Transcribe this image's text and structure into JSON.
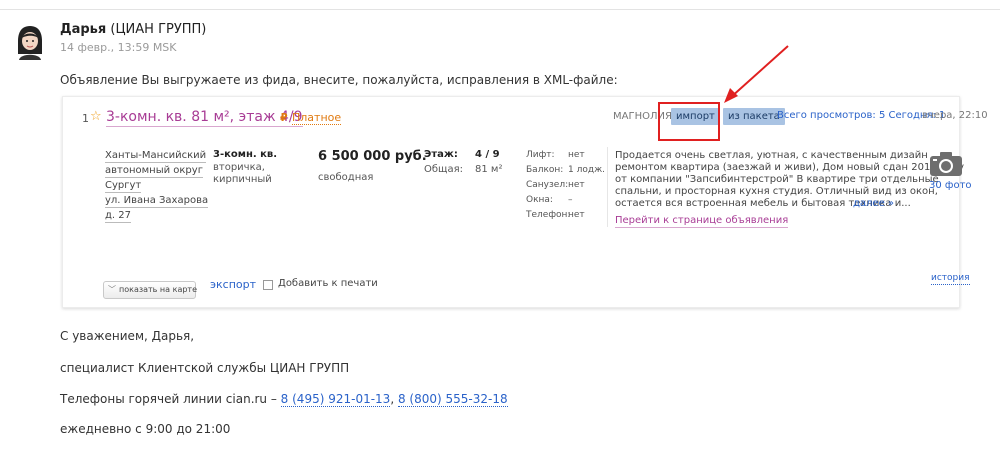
{
  "message": {
    "sender_name": "Дарья",
    "sender_org": "(ЦИАН ГРУПП)",
    "date": "14 февр., 13:59 MSK",
    "intro": "Объявление Вы выгружаете из фида, внесите, пожалуйста, исправления в XML-файле:"
  },
  "listing": {
    "number": "1",
    "title": "3-комн. кв. 81 м², этаж 4/9",
    "paid_symbol": "₽",
    "paid_label": "Платное",
    "agency": "МАГНОЛИЯ",
    "badge_import": "импорт",
    "badge_package": "из пакета",
    "views": "Всего просмотров: 5 Сегодня: 1",
    "timestamp": "вчера, 22:10",
    "address": [
      "Ханты-Мансийский",
      "автономный округ",
      "Сургут",
      "ул. Ивана Захарова",
      "д. 27"
    ],
    "rooms": "3-комн. кв.",
    "rooms_sub": [
      "вторичка,",
      "кирпичный"
    ],
    "price": "6 500 000 руб.",
    "price_sub": "свободная",
    "floor_label": "Этаж:",
    "floor_value": "4 / 9",
    "area_label": "Общая:",
    "area_value": "81 м²",
    "features": [
      {
        "label": "Лифт:",
        "value": "нет"
      },
      {
        "label": "Балкон:",
        "value": "1 лодж."
      },
      {
        "label": "Санузел:",
        "value": "нет"
      },
      {
        "label": "Окна:",
        "value": "–"
      },
      {
        "label": "Телефон:",
        "value": "нет"
      }
    ],
    "description": [
      "Продается очень светлая, уютная, с качественным дизайн",
      "ремонтом квартира (заезжай и живи), Дом новый сдан 2010 году",
      "от компании \"Запсибинтерстрой\" В квартире три отдельные",
      "спальни, и просторная кухня студия. Отличный вид из окон,",
      "остается вся встроенная мебель и бытовая техника и..."
    ],
    "more": "далее »",
    "goto_link": "Перейти к странице объявления",
    "photos": "30 фото",
    "map_button": "показать на карте",
    "export": "экспорт",
    "print_label": "Добавить к печати",
    "history": "история"
  },
  "signature": {
    "greeting": "С уважением, Дарья,",
    "role": "специалист Клиентской службы ЦИАН ГРУПП",
    "phones_prefix": "Телефоны горячей линии cian.ru – ",
    "phone1": "8 (495) 921-01-13",
    "separator": ", ",
    "phone2": "8 (800) 555-32-18",
    "hours": "ежедневно с 9:00 до 21:00"
  },
  "colors": {
    "title": "#a83c95",
    "link": "#2a62c9",
    "badge": "#a9c3e3",
    "highlight": "#e02020",
    "paid": "#e07a10"
  }
}
